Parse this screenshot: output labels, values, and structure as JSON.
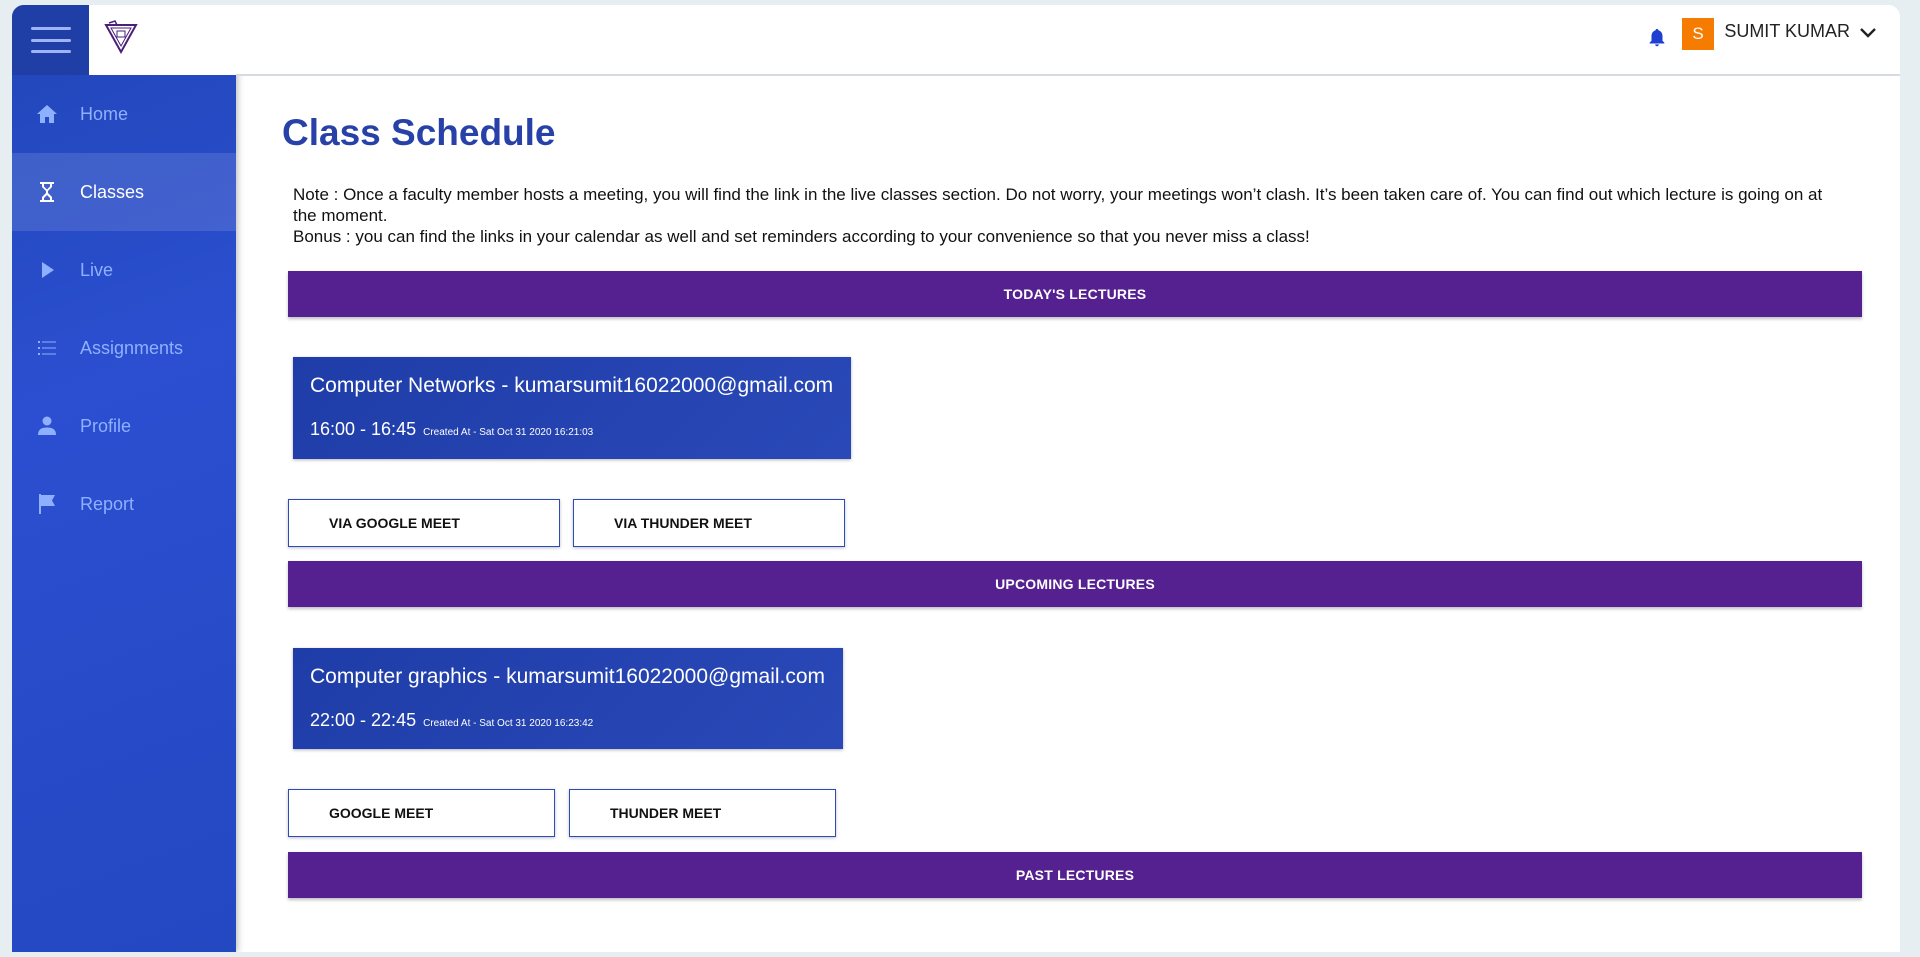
{
  "header": {
    "user_initial": "S",
    "user_name": "SUMIT KUMAR"
  },
  "sidebar": {
    "items": [
      {
        "label": "Home",
        "icon": "home-icon"
      },
      {
        "label": "Classes",
        "icon": "hourglass-icon",
        "active": true
      },
      {
        "label": "Live",
        "icon": "play-icon"
      },
      {
        "label": "Assignments",
        "icon": "list-icon"
      },
      {
        "label": "Profile",
        "icon": "person-icon"
      },
      {
        "label": "Report",
        "icon": "flag-icon"
      }
    ]
  },
  "main": {
    "title": "Class Schedule",
    "note": "Note : Once a faculty member hosts a meeting, you will find the link in the live classes section. Do not worry, your meetings won’t clash. It’s been taken care of. You can find out which lecture is going on at the moment.",
    "bonus": "Bonus : you can find the links in your calendar as well and set reminders according to your convenience so that you never miss a class!",
    "sections": {
      "today": "TODAY'S LECTURES",
      "upcoming": "UPCOMING LECTURES",
      "past": "PAST LECTURES"
    },
    "today_lecture": {
      "title": "Computer Networks - kumarsumit16022000@gmail.com",
      "time": "16:00 - 16:45",
      "created": "Created At - Sat Oct 31 2020 16:21:03",
      "btn1": "VIA GOOGLE MEET",
      "btn2": "VIA THUNDER MEET"
    },
    "upcoming_lecture": {
      "title": "Computer graphics - kumarsumit16022000@gmail.com",
      "time": "22:00 - 22:45",
      "created": "Created At - Sat Oct 31 2020 16:23:42",
      "btn1": "GOOGLE MEET",
      "btn2": "THUNDER MEET"
    }
  },
  "colors": {
    "sidebar": "#2447c2",
    "band": "#55208f",
    "title": "#2741a8",
    "avatar": "#f57c00"
  }
}
